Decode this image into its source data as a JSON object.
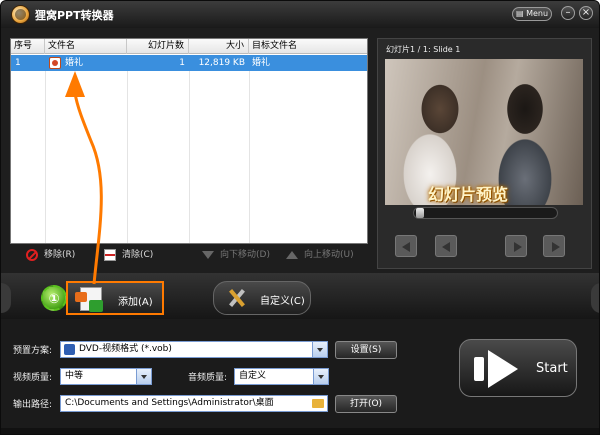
{
  "window": {
    "title": "狸窝PPT转换器",
    "menu_label": "Menu",
    "minimize_label": "–",
    "close_label": "×"
  },
  "file_list": {
    "columns": [
      "序号",
      "文件名",
      "幻灯片数",
      "大小",
      "目标文件名"
    ],
    "rows": [
      {
        "index": "1",
        "file_name": "婚礼",
        "slides": "1",
        "size": "12,819 KB",
        "target_name": "婚礼",
        "selected": true
      }
    ]
  },
  "list_toolbar": {
    "remove": "移除(R)",
    "clear": "清除(C)",
    "move_down": "向下移动(D)",
    "move_up": "向上移动(U)"
  },
  "preview": {
    "label": "幻灯片1 / 1: Slide 1",
    "caption": "幻灯片预览",
    "seek_position": 0
  },
  "actions": {
    "step_badge": "①",
    "add": "添加(A)",
    "custom": "自定义(C)"
  },
  "settings": {
    "preset_label": "预置方案:",
    "preset_value": "DVD-视频格式 (*.vob)",
    "settings_button": "设置(S)",
    "video_quality_label": "视频质量:",
    "video_quality_value": "中等",
    "audio_quality_label": "音频质量:",
    "audio_quality_value": "自定义",
    "output_label": "输出路径:",
    "output_path": "C:\\Documents and Settings\\Administrator\\桌面",
    "open_button": "打开(O)",
    "start_button": "Start"
  },
  "colors": {
    "accent_orange": "#ff7a00",
    "selection_blue": "#3a8fde",
    "panel_dark": "#1e1e1e"
  }
}
